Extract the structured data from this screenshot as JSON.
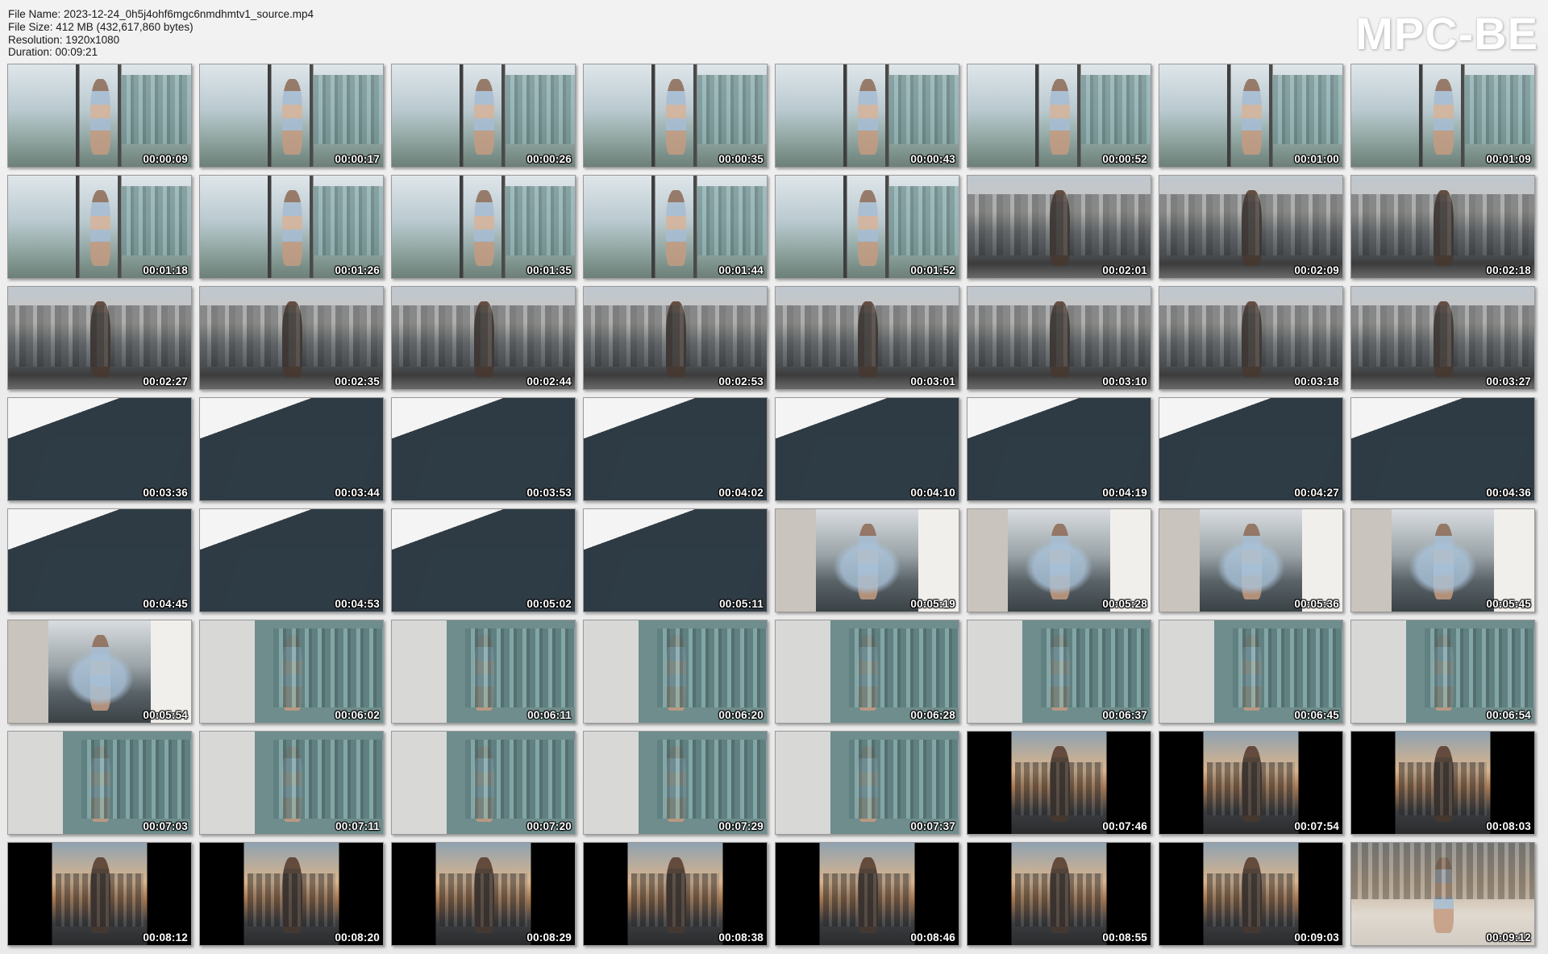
{
  "info": {
    "file_name": "File Name: 2023-12-24_0h5j4ohf6mgc6nmdhmtv1_source.mp4",
    "file_size": "File Size: 412 MB (432,617,860 bytes)",
    "resolution": "Resolution: 1920x1080",
    "duration": "Duration: 00:09:21"
  },
  "logo": "MPC-BE",
  "thumbnails": [
    {
      "time": "00:00:09",
      "scene": "s-window"
    },
    {
      "time": "00:00:17",
      "scene": "s-window"
    },
    {
      "time": "00:00:26",
      "scene": "s-window"
    },
    {
      "time": "00:00:35",
      "scene": "s-window"
    },
    {
      "time": "00:00:43",
      "scene": "s-window"
    },
    {
      "time": "00:00:52",
      "scene": "s-window"
    },
    {
      "time": "00:01:00",
      "scene": "s-window"
    },
    {
      "time": "00:01:09",
      "scene": "s-window"
    },
    {
      "time": "00:01:18",
      "scene": "s-window"
    },
    {
      "time": "00:01:26",
      "scene": "s-window"
    },
    {
      "time": "00:01:35",
      "scene": "s-window"
    },
    {
      "time": "00:01:44",
      "scene": "s-window"
    },
    {
      "time": "00:01:52",
      "scene": "s-window"
    },
    {
      "time": "00:02:01",
      "scene": "s-city"
    },
    {
      "time": "00:02:09",
      "scene": "s-city"
    },
    {
      "time": "00:02:18",
      "scene": "s-city"
    },
    {
      "time": "00:02:27",
      "scene": "s-city"
    },
    {
      "time": "00:02:35",
      "scene": "s-city"
    },
    {
      "time": "00:02:44",
      "scene": "s-city"
    },
    {
      "time": "00:02:53",
      "scene": "s-city"
    },
    {
      "time": "00:03:01",
      "scene": "s-city"
    },
    {
      "time": "00:03:10",
      "scene": "s-city"
    },
    {
      "time": "00:03:18",
      "scene": "s-city"
    },
    {
      "time": "00:03:27",
      "scene": "s-city"
    },
    {
      "time": "00:03:36",
      "scene": "s-floor"
    },
    {
      "time": "00:03:44",
      "scene": "s-floor"
    },
    {
      "time": "00:03:53",
      "scene": "s-floor"
    },
    {
      "time": "00:04:02",
      "scene": "s-floor"
    },
    {
      "time": "00:04:10",
      "scene": "s-floor"
    },
    {
      "time": "00:04:19",
      "scene": "s-floor"
    },
    {
      "time": "00:04:27",
      "scene": "s-floor"
    },
    {
      "time": "00:04:36",
      "scene": "s-floor"
    },
    {
      "time": "00:04:45",
      "scene": "s-floor"
    },
    {
      "time": "00:04:53",
      "scene": "s-floor"
    },
    {
      "time": "00:05:02",
      "scene": "s-floor"
    },
    {
      "time": "00:05:11",
      "scene": "s-floor"
    },
    {
      "time": "00:05:19",
      "scene": "s-room"
    },
    {
      "time": "00:05:28",
      "scene": "s-room"
    },
    {
      "time": "00:05:36",
      "scene": "s-room"
    },
    {
      "time": "00:05:45",
      "scene": "s-room"
    },
    {
      "time": "00:05:54",
      "scene": "s-room"
    },
    {
      "time": "00:06:02",
      "scene": "s-tall"
    },
    {
      "time": "00:06:11",
      "scene": "s-tall"
    },
    {
      "time": "00:06:20",
      "scene": "s-tall"
    },
    {
      "time": "00:06:28",
      "scene": "s-tall"
    },
    {
      "time": "00:06:37",
      "scene": "s-tall"
    },
    {
      "time": "00:06:45",
      "scene": "s-tall"
    },
    {
      "time": "00:06:54",
      "scene": "s-tall"
    },
    {
      "time": "00:07:03",
      "scene": "s-tall"
    },
    {
      "time": "00:07:11",
      "scene": "s-tall"
    },
    {
      "time": "00:07:20",
      "scene": "s-tall"
    },
    {
      "time": "00:07:29",
      "scene": "s-tall"
    },
    {
      "time": "00:07:37",
      "scene": "s-tall"
    },
    {
      "time": "00:07:46",
      "scene": "s-black"
    },
    {
      "time": "00:07:54",
      "scene": "s-black"
    },
    {
      "time": "00:08:03",
      "scene": "s-black"
    },
    {
      "time": "00:08:12",
      "scene": "s-black"
    },
    {
      "time": "00:08:20",
      "scene": "s-black"
    },
    {
      "time": "00:08:29",
      "scene": "s-black"
    },
    {
      "time": "00:08:38",
      "scene": "s-black"
    },
    {
      "time": "00:08:46",
      "scene": "s-black"
    },
    {
      "time": "00:08:55",
      "scene": "s-black"
    },
    {
      "time": "00:09:03",
      "scene": "s-black"
    },
    {
      "time": "00:09:12",
      "scene": "s-last"
    }
  ]
}
